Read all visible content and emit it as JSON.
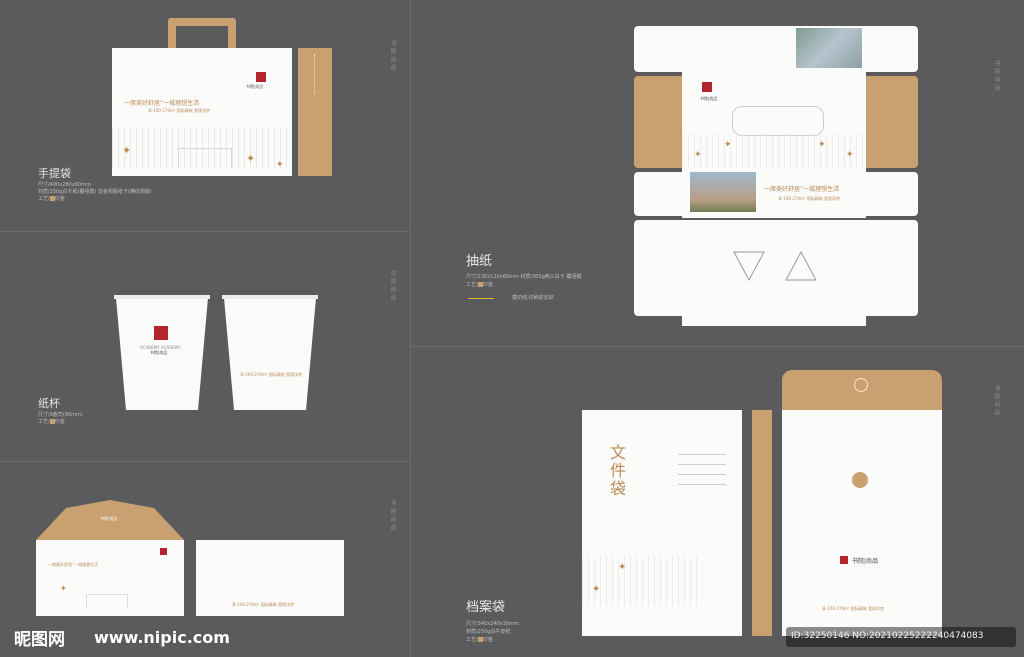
{
  "brand": {
    "name": "书院",
    "sub": "尚品",
    "lockup": "书院|尚品",
    "en": "ACADEMY ACADEMY",
    "slogan": "一席美好舒居”一城理想生活",
    "subslogan": "享·100-270m² 国际精装 宽境洋房",
    "colors": {
      "background": "#5b5b5d",
      "kraft": "#c9a06f",
      "red": "#b3242c",
      "gold": "#b98a55"
    }
  },
  "side_mark": "书院尚品",
  "handbag": {
    "title": "手提袋",
    "spec1": "尺寸/400x280x80mm",
    "spec2": "材质/250g白卡纸(覆哑膜)  烫金铜版纸卡(横纹铜版)",
    "craft_prefix": "工艺/",
    "craft": "印金"
  },
  "cup": {
    "title": "纸杯",
    "spec1": "尺寸/9盎司(86mm)",
    "craft_prefix": "工艺/",
    "craft": "印金"
  },
  "tissue": {
    "title": "抽纸",
    "spec1": "尺寸/230x120x60mm    材质/300g两三白卡  覆哑膜",
    "craft_prefix": "工艺/",
    "craft": "印金",
    "legend": "模切线,印刷前去掉"
  },
  "folder": {
    "title": "档案袋",
    "spec1": "尺寸/340x240x30mm",
    "spec2": "材质/250g白牛皮纸",
    "craft_prefix": "工艺/",
    "craft": "印金",
    "doc_title": "文件袋"
  },
  "watermark": {
    "site": "昵图网",
    "url": "www.nipic.com",
    "id": "ID:32250146 NO:20210225222240474083"
  }
}
